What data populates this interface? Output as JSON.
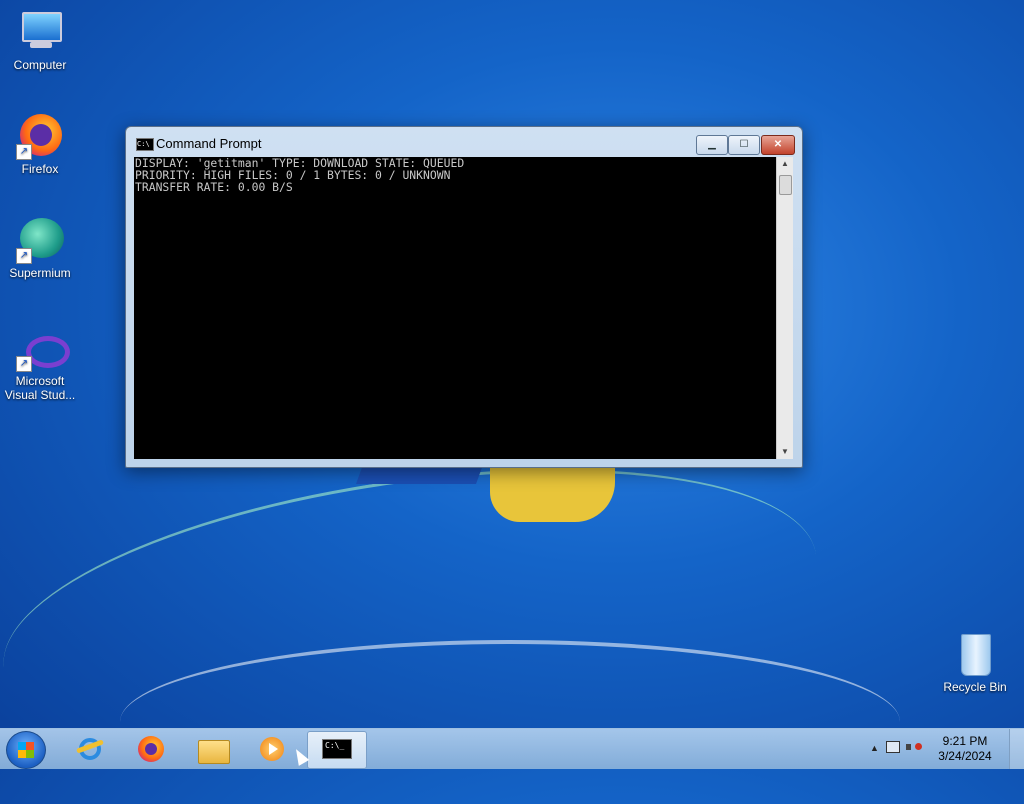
{
  "desktop": {
    "icons": [
      {
        "label": "Computer",
        "icon": "computer-icon"
      },
      {
        "label": "Firefox",
        "icon": "firefox-icon"
      },
      {
        "label": "Supermium",
        "icon": "supermium-icon"
      },
      {
        "label": "Microsoft Visual Stud...",
        "icon": "visual-studio-icon"
      },
      {
        "label": "Recycle Bin",
        "icon": "recycle-bin-icon"
      }
    ]
  },
  "window": {
    "title": "Command Prompt",
    "mini_icon_text": "C:\\",
    "buttons": {
      "minimize": "▁",
      "maximize": "☐",
      "close": "✕"
    },
    "console_lines": [
      "DISPLAY: 'getitman' TYPE: DOWNLOAD STATE: QUEUED",
      "PRIORITY: HIGH FILES: 0 / 1 BYTES: 0 / UNKNOWN",
      "TRANSFER RATE: 0.00 B/S"
    ]
  },
  "taskbar": {
    "items": [
      {
        "icon": "internet-explorer-icon"
      },
      {
        "icon": "firefox-icon"
      },
      {
        "icon": "file-explorer-icon"
      },
      {
        "icon": "media-player-icon"
      },
      {
        "icon": "command-prompt-icon",
        "active": true
      }
    ],
    "cmd_glyph": "C:\\_",
    "tray": {
      "show_hidden": "▲",
      "time": "9:21 PM",
      "date": "3/24/2024"
    }
  },
  "colors": {
    "console_bg": "#000000",
    "console_fg": "#c8c8c8",
    "close_red": "#c2432c"
  }
}
